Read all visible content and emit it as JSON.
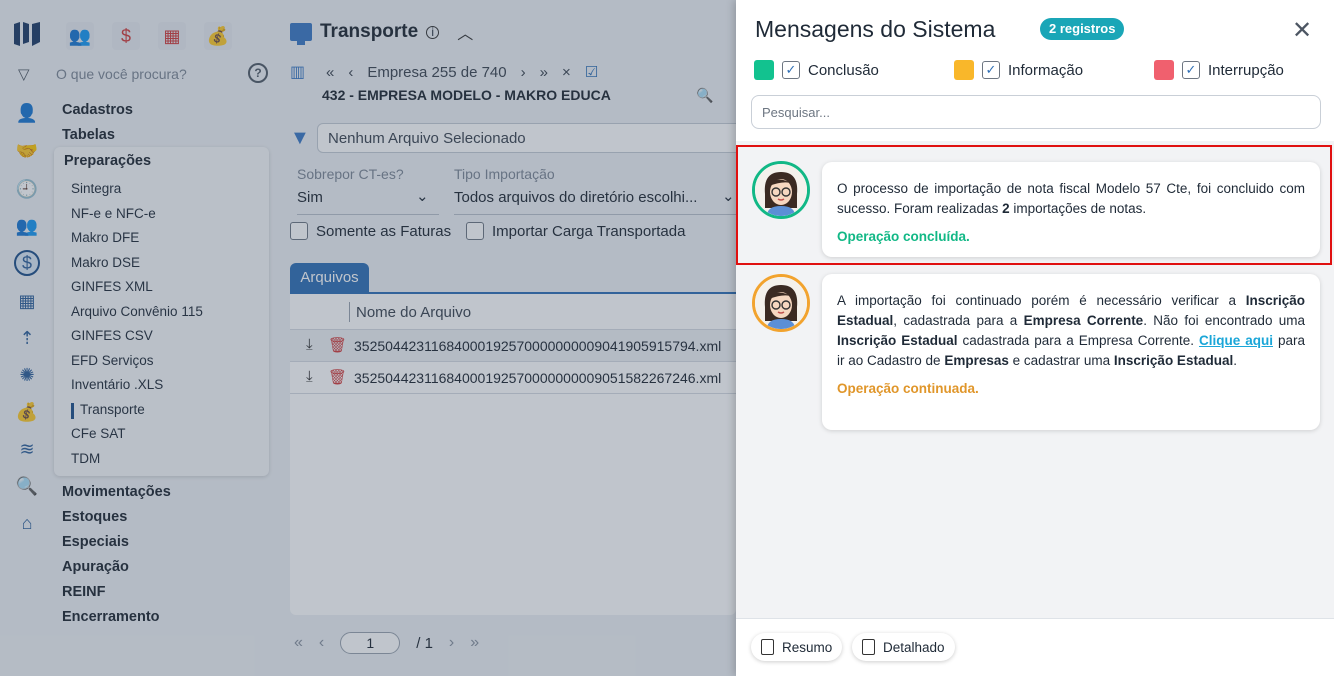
{
  "topbar": {
    "search_placeholder": "O que você procura?",
    "help_symbol": "?"
  },
  "menu": {
    "top_items": [
      "Cadastros",
      "Tabelas"
    ],
    "open_group": "Preparações",
    "sub_items": [
      "Sintegra",
      "NF-e e NFC-e",
      "Makro DFE",
      "Makro DSE",
      "GINFES XML",
      "Arquivo Convênio 115",
      "GINFES CSV",
      "EFD Serviços",
      "Inventário .XLS",
      "Transporte",
      "CFe SAT",
      "TDM"
    ],
    "bottom_items": [
      "Movimentações",
      "Estoques",
      "Especiais",
      "Apuração",
      "REINF",
      "Encerramento"
    ]
  },
  "main": {
    "title": "Transporte",
    "nav": {
      "first": "«",
      "prev": "‹",
      "position": "Empresa 255 de 740",
      "next": "›",
      "last": "»",
      "clear": "×"
    },
    "company": "432 - EMPRESA MODELO - MAKRO EDUCA",
    "file_selector": "Nenhum Arquivo Selecionado",
    "sobrepor_label": "Sobrepor CT-es?",
    "sobrepor_value": "Sim",
    "tipo_label": "Tipo Importação",
    "tipo_value": "Todos arquivos do diretório escolhi...",
    "chk_faturas": "Somente as Faturas",
    "chk_carga": "Importar Carga Transportada",
    "tab": "Arquivos",
    "col_header": "Nome do Arquivo",
    "files": [
      "35250442311684000192570000000009041905915794.xml",
      "35250442311684000192570000000009051582267246.xml"
    ],
    "pager": {
      "first": "«",
      "prev": "‹",
      "page": "1",
      "of": "/ 1",
      "next": "›",
      "last": "»"
    }
  },
  "drawer": {
    "title": "Mensagens do Sistema",
    "badge": "2 registros",
    "close": "✕",
    "legend": [
      {
        "label": "Conclusão",
        "color": "#12c28f"
      },
      {
        "label": "Informação",
        "color": "#f9b72a"
      },
      {
        "label": "Interrupção",
        "color": "#f0606e"
      }
    ],
    "search_placeholder": "Pesquisar...",
    "msg1_status": "Operação concluída.",
    "msg2_status": "Operação continuada.",
    "footer_resumo": "Resumo",
    "footer_detalhado": "Detalhado"
  }
}
